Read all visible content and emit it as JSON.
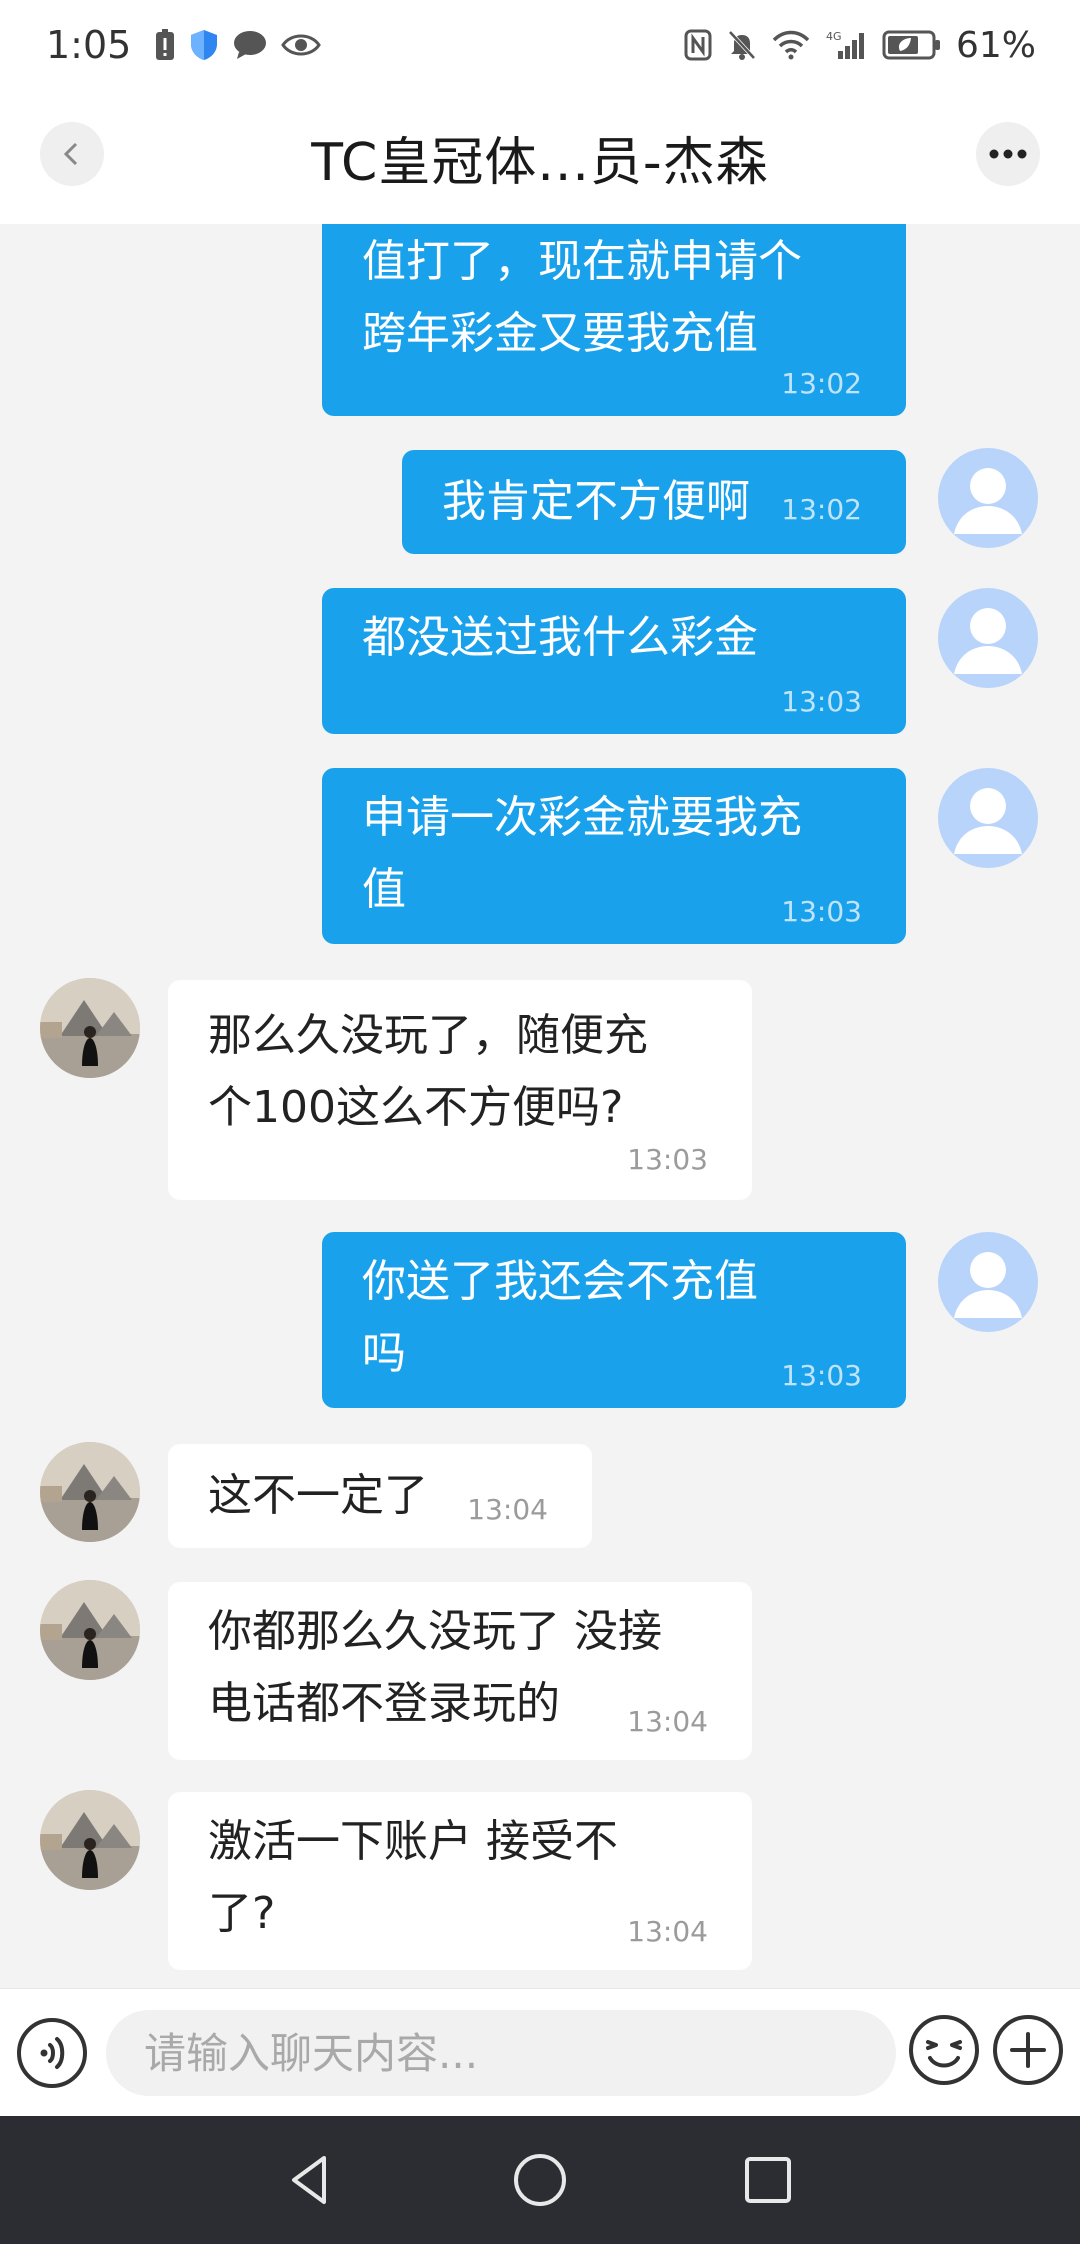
{
  "status_bar": {
    "time": "1:05",
    "network": "4G",
    "battery": "61%"
  },
  "header": {
    "title": "TC皇冠体...员-杰森"
  },
  "messages": [
    {
      "side": "out",
      "lines": [
        "值打了，现在就申请个",
        "跨年彩金又要我充值"
      ],
      "time": "13:02"
    },
    {
      "side": "out",
      "lines": [
        "我肯定不方便啊"
      ],
      "time": "13:02"
    },
    {
      "side": "out",
      "lines": [
        "都没送过我什么彩金"
      ],
      "time": "13:03"
    },
    {
      "side": "out",
      "lines": [
        "申请一次彩金就要我充",
        "值"
      ],
      "time": "13:03"
    },
    {
      "side": "in",
      "lines": [
        "那么久没玩了，随便充",
        "个100这么不方便吗?"
      ],
      "time": "13:03"
    },
    {
      "side": "out",
      "lines": [
        "你送了我还会不充值",
        "吗"
      ],
      "time": "13:03"
    },
    {
      "side": "in",
      "lines": [
        "这不一定了"
      ],
      "time": "13:04"
    },
    {
      "side": "in",
      "lines": [
        "你都那么久没玩了 没接",
        "电话都不登录玩的"
      ],
      "time": "13:04"
    },
    {
      "side": "in",
      "lines": [
        "激活一下账户 接受不",
        "了?"
      ],
      "time": "13:04"
    }
  ],
  "input": {
    "placeholder": "请输入聊天内容..."
  },
  "colors": {
    "outgoing_bubble": "#1aa1ec",
    "incoming_bubble": "#ffffff",
    "chat_background": "#f3f3f3",
    "nav_bar": "#2b2d33"
  },
  "icons": {
    "back": "chevron-left-icon",
    "more": "more-dots-icon",
    "voice": "voice-icon",
    "emoji": "emoji-icon",
    "plus": "plus-icon"
  }
}
